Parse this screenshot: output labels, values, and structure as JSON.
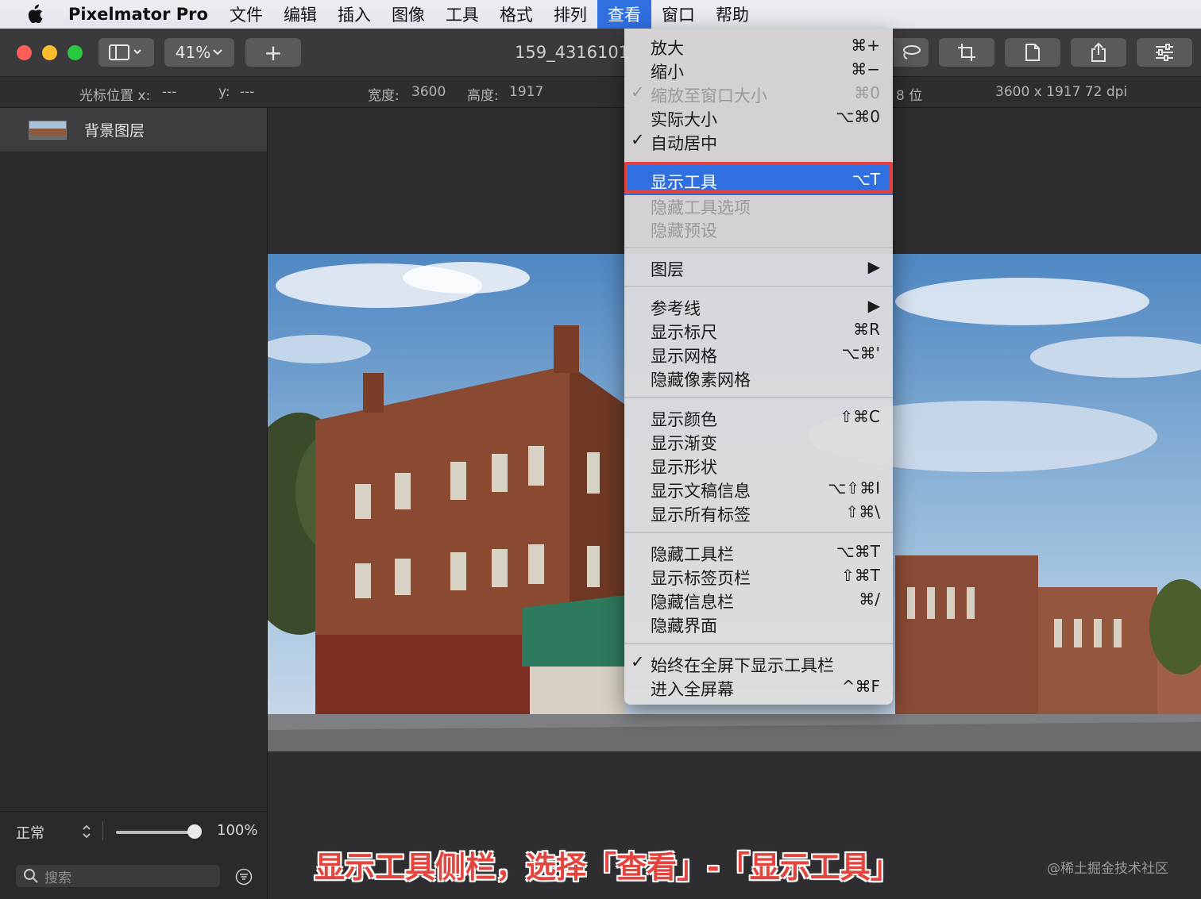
{
  "menubar": {
    "app_name": "Pixelmator Pro",
    "menus": [
      "文件",
      "编辑",
      "插入",
      "图像",
      "工具",
      "格式",
      "排列",
      "查看",
      "窗口",
      "帮助"
    ],
    "active_menu": "查看"
  },
  "toolbar": {
    "zoom": "41%",
    "add_label": "+",
    "doc_title": "159_4316101"
  },
  "infobar": {
    "cursor_x_label": "光标位置 x:",
    "cursor_x_value": "---",
    "cursor_y_label": "y:",
    "cursor_y_value": "---",
    "width_label": "宽度:",
    "width_value": "3600",
    "height_label": "高度:",
    "height_value": "1917",
    "bit_depth": "8 位",
    "resolution": "3600 x 1917 72 dpi"
  },
  "sidebar": {
    "layer_name": "背景图层",
    "blend_mode": "正常",
    "opacity": "100%",
    "opacity_fraction": 1.0,
    "search_placeholder": "搜索"
  },
  "view_menu": {
    "items": [
      {
        "label": "放大",
        "shortcut": "⌘+",
        "checked": false,
        "disabled": false
      },
      {
        "label": "缩小",
        "shortcut": "⌘−",
        "checked": false,
        "disabled": false
      },
      {
        "label": "缩放至窗口大小",
        "shortcut": "⌘0",
        "checked": true,
        "disabled": true
      },
      {
        "label": "实际大小",
        "shortcut": "⌥⌘0",
        "checked": false,
        "disabled": false
      },
      {
        "label": "自动居中",
        "shortcut": "",
        "checked": true,
        "disabled": false
      },
      {
        "label": "显示工具",
        "shortcut": "⌥T",
        "checked": false,
        "disabled": false,
        "selected": true
      },
      {
        "label": "隐藏工具选项",
        "shortcut": "",
        "checked": false,
        "disabled": true
      },
      {
        "label": "隐藏预设",
        "shortcut": "",
        "checked": false,
        "disabled": true
      },
      {
        "label": "图层",
        "shortcut": "▶",
        "checked": false,
        "disabled": false
      },
      {
        "label": "参考线",
        "shortcut": "▶",
        "checked": false,
        "disabled": false
      },
      {
        "label": "显示标尺",
        "shortcut": "⌘R",
        "checked": false,
        "disabled": false
      },
      {
        "label": "显示网格",
        "shortcut": "⌥⌘'",
        "checked": false,
        "disabled": false
      },
      {
        "label": "隐藏像素网格",
        "shortcut": "",
        "checked": false,
        "disabled": false
      },
      {
        "label": "显示颜色",
        "shortcut": "⇧⌘C",
        "checked": false,
        "disabled": false
      },
      {
        "label": "显示渐变",
        "shortcut": "",
        "checked": false,
        "disabled": false
      },
      {
        "label": "显示形状",
        "shortcut": "",
        "checked": false,
        "disabled": false
      },
      {
        "label": "显示文稿信息",
        "shortcut": "⌥⇧⌘I",
        "checked": false,
        "disabled": false
      },
      {
        "label": "显示所有标签",
        "shortcut": "⇧⌘\\",
        "checked": false,
        "disabled": false
      },
      {
        "label": "隐藏工具栏",
        "shortcut": "⌥⌘T",
        "checked": false,
        "disabled": false
      },
      {
        "label": "显示标签页栏",
        "shortcut": "⇧⌘T",
        "checked": false,
        "disabled": false
      },
      {
        "label": "隐藏信息栏",
        "shortcut": "⌘/",
        "checked": false,
        "disabled": false
      },
      {
        "label": "隐藏界面",
        "shortcut": "",
        "checked": false,
        "disabled": false
      },
      {
        "label": "始终在全屏下显示工具栏",
        "shortcut": "",
        "checked": true,
        "disabled": false
      },
      {
        "label": "进入全屏幕",
        "shortcut": "^⌘F",
        "checked": false,
        "disabled": false
      }
    ],
    "check_glyph": "✓"
  },
  "caption": "显示工具侧栏，选择「查看」-「显示工具」",
  "watermark": "@稀土掘金技术社区",
  "colors": {
    "accent": "#2f6fe0",
    "highlight_outline": "#e6413b",
    "caption": "#e2443e"
  }
}
